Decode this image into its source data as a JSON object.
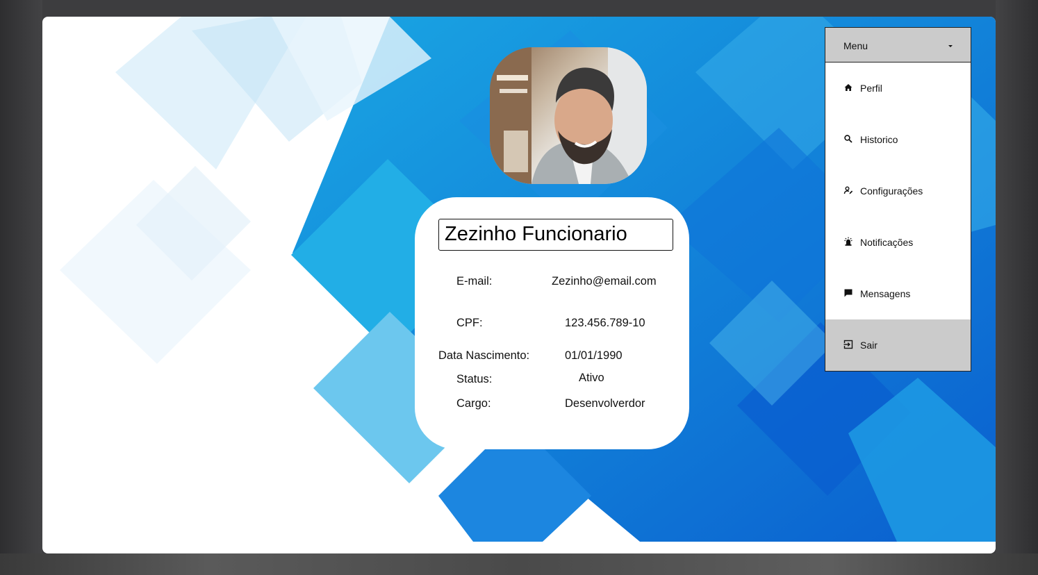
{
  "profile": {
    "name": "Zezinho Funcionario",
    "email_label": "E-mail:",
    "email_value": "Zezinho@email.com",
    "cpf_label": "CPF:",
    "cpf_value": "123.456.789-10",
    "birth_label": "Data Nascimento:",
    "birth_value": "01/01/1990",
    "status_label": "Status:",
    "status_value": "Ativo",
    "role_label": "Cargo:",
    "role_value": "Desenvolverdor"
  },
  "menu": {
    "title": "Menu",
    "items": [
      {
        "label": "Perfil",
        "icon": "home-icon"
      },
      {
        "label": "Historico",
        "icon": "search-icon"
      },
      {
        "label": "Configurações",
        "icon": "person-edit-icon"
      },
      {
        "label": "Notificações",
        "icon": "alarm-light-icon"
      },
      {
        "label": "Mensagens",
        "icon": "message-icon"
      },
      {
        "label": "Sair",
        "icon": "logout-icon"
      }
    ]
  },
  "colors": {
    "accent_blue": "#0b6fd6",
    "light_blue": "#2ab0e6",
    "menu_active_bg": "#cbcbcb"
  }
}
